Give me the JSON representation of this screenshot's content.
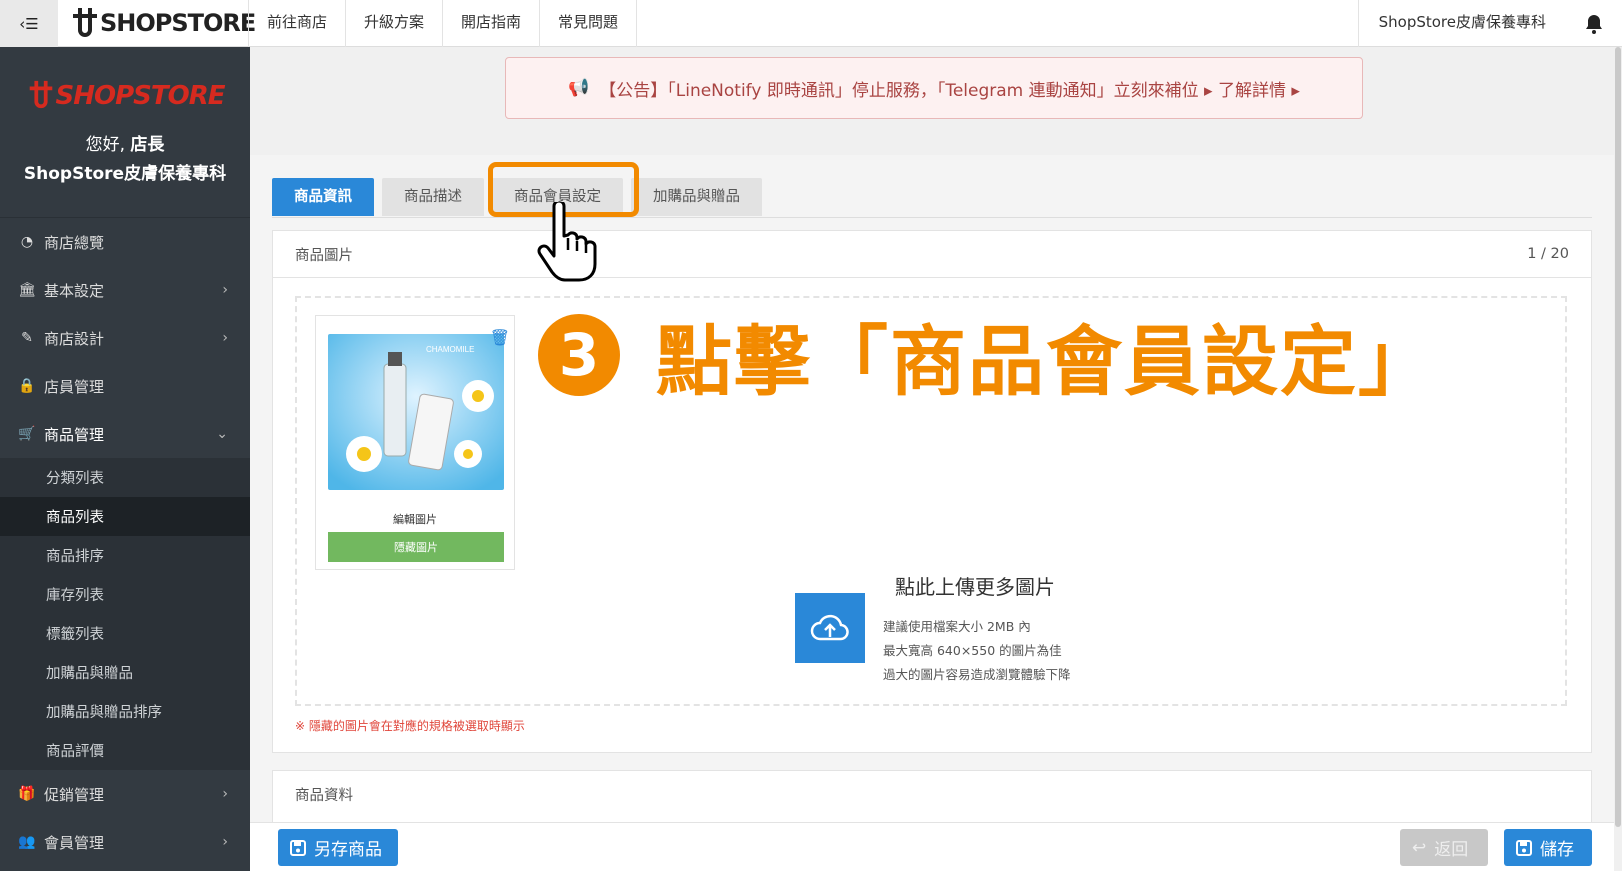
{
  "topbar": {
    "brand": "SHOPSTORE",
    "nav": [
      "前往商店",
      "升級方案",
      "開店指南",
      "常見問題"
    ],
    "store_name": "ShopStore皮膚保養專科"
  },
  "sidebar": {
    "brand": "SHOPSTORE",
    "greeting": "您好,",
    "role": "店長",
    "store_name": "ShopStore皮膚保養專科",
    "items": [
      {
        "label": "商店總覽",
        "icon": "dashboard-icon"
      },
      {
        "label": "基本設定",
        "icon": "bank-icon"
      },
      {
        "label": "商店設計",
        "icon": "brush-icon"
      },
      {
        "label": "店員管理",
        "icon": "lock-icon"
      },
      {
        "label": "商品管理",
        "icon": "cart-icon"
      },
      {
        "label": "促銷管理",
        "icon": "gift-icon"
      },
      {
        "label": "會員管理",
        "icon": "users-icon"
      }
    ],
    "sub_items": [
      "分類列表",
      "商品列表",
      "商品排序",
      "庫存列表",
      "標籤列表",
      "加購品與贈品",
      "加購品與贈品排序",
      "商品評價"
    ]
  },
  "announcement": "【公告】「LineNotify 即時通訊」停止服務，「Telegram 連動通知」立刻來補位 ▸ 了解詳情 ▸",
  "tabs": [
    "商品資訊",
    "商品描述",
    "商品會員設定",
    "加購品與贈品"
  ],
  "images_panel": {
    "title": "商品圖片",
    "count": "1 / 20",
    "edit_image": "編輯圖片",
    "hide_image": "隱藏圖片",
    "thumb_label": "CHAMOMILE",
    "upload_title": "點此上傳更多圖片",
    "upload_hint_1": "建議使用檔案大小 2MB 內",
    "upload_hint_2": "最大寬高 640×550 的圖片為佳",
    "upload_hint_3": "過大的圖片容易造成瀏覽體驗下降",
    "note": "※ 隱藏的圖片會在對應的規格被選取時顯示"
  },
  "data_panel": {
    "title": "商品資料"
  },
  "footer": {
    "save_as": "另存商品",
    "back": "返回",
    "save": "儲存"
  },
  "annotation": {
    "step": "3",
    "text": "點擊「商品會員設定」"
  },
  "colors": {
    "accent": "#2a88d8",
    "highlight": "#f28a00",
    "sidebar": "#333a41",
    "brand_red": "#d62a1f"
  }
}
